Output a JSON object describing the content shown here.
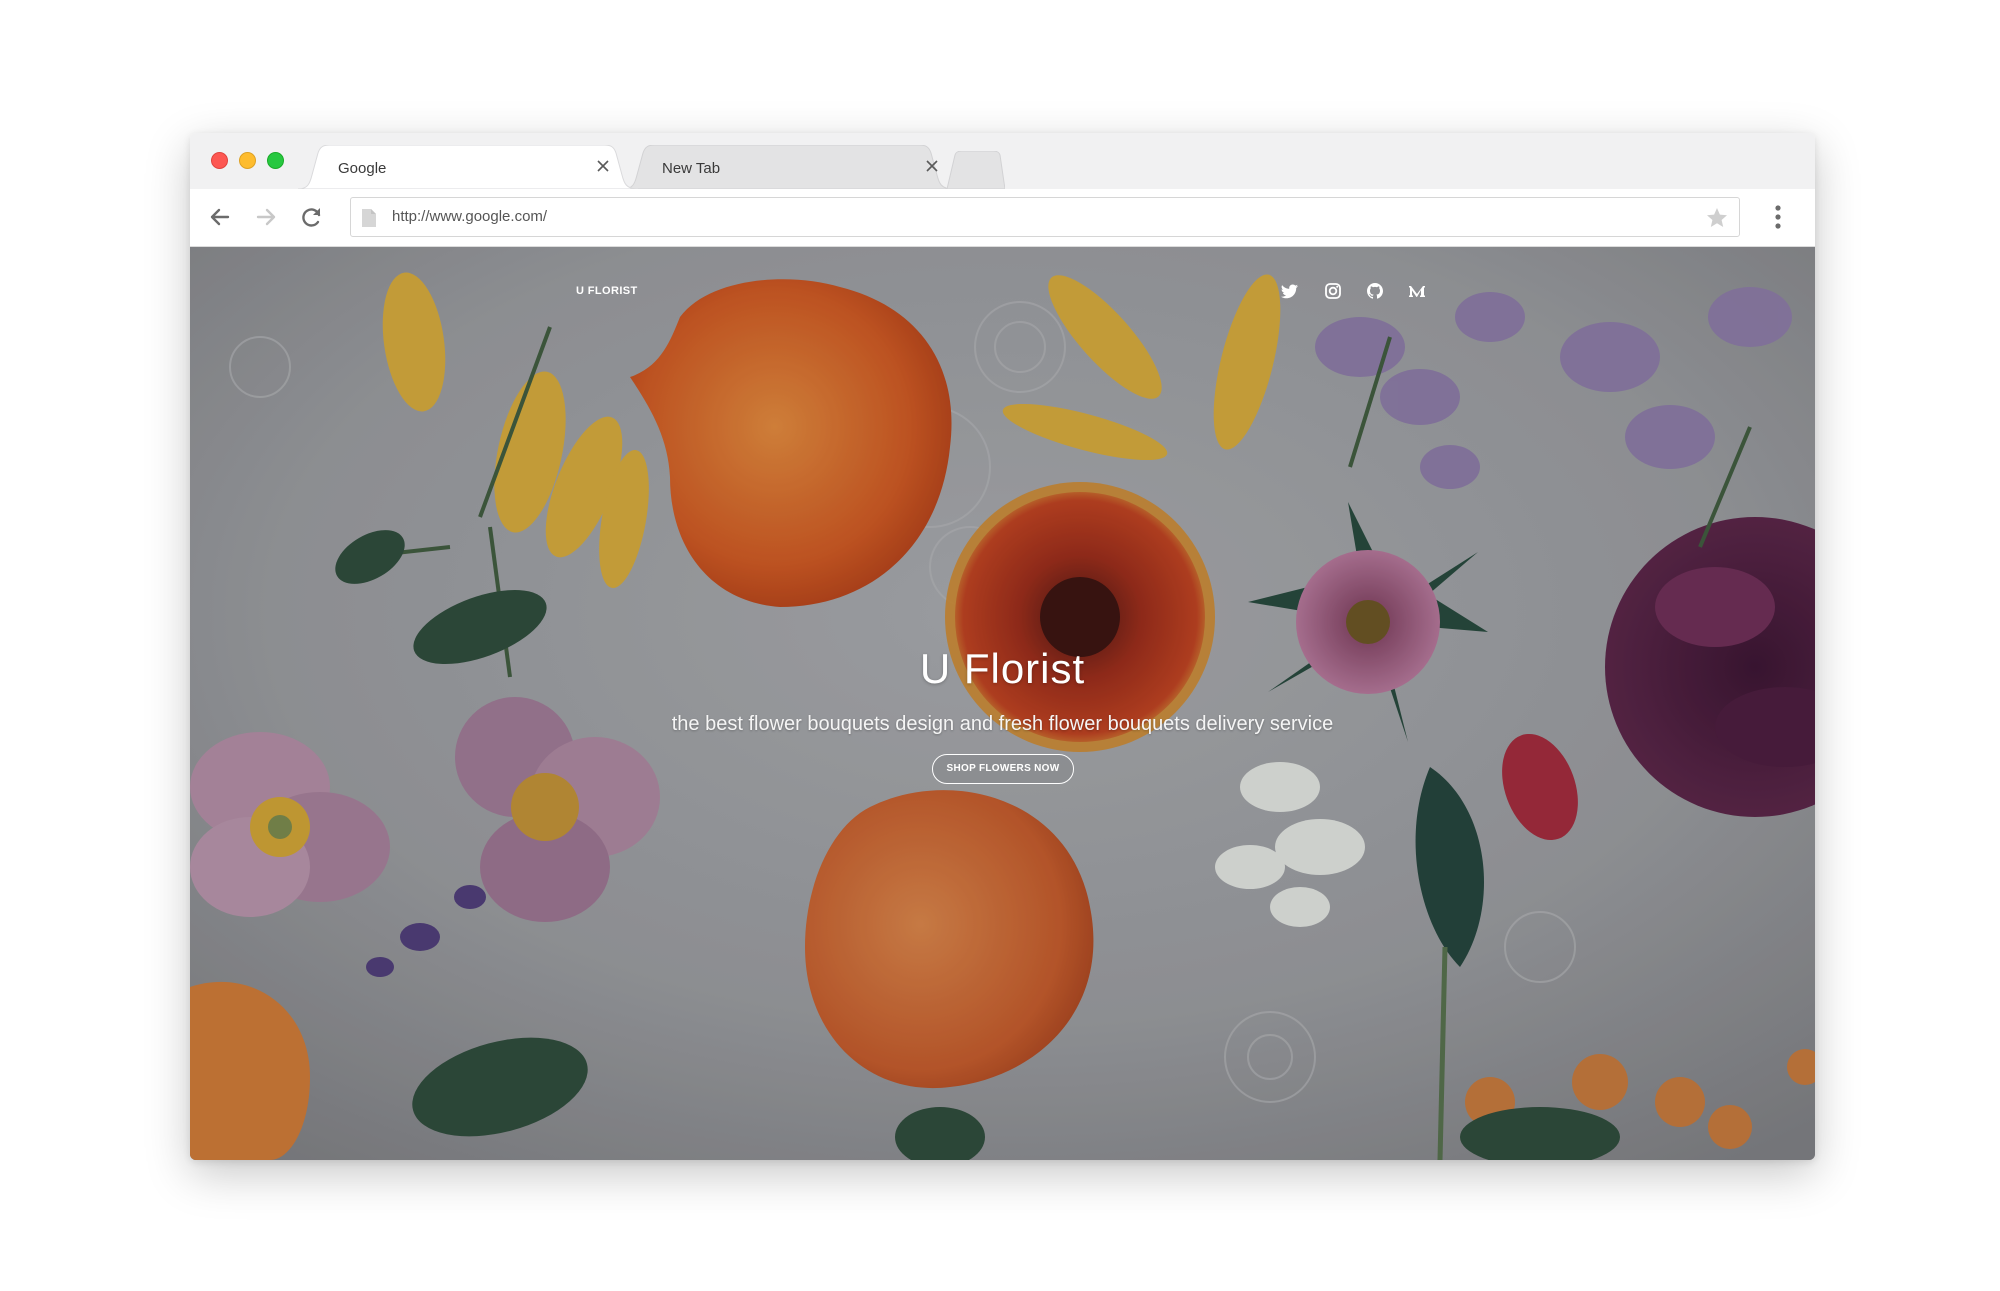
{
  "browser": {
    "tabs": [
      {
        "title": "Google"
      },
      {
        "title": "New Tab"
      }
    ],
    "address_bar": {
      "url": "http://www.google.com/"
    }
  },
  "site": {
    "brand": "U FLORIST",
    "social_icons": [
      "twitter-icon",
      "instagram-icon",
      "github-icon",
      "medium-icon"
    ],
    "hero": {
      "title": "U Florist",
      "subtitle": "the best flower bouquets design and fresh flower bouquets delivery service",
      "cta_label": "SHOP FLOWERS NOW"
    }
  },
  "colors": {
    "traffic_red": "#fd5752",
    "traffic_yellow": "#febc2e",
    "traffic_green": "#27c840",
    "tab_active": "#ffffff",
    "tab_inactive": "#e3e3e4",
    "tabstrip": "#f1f1f2"
  }
}
